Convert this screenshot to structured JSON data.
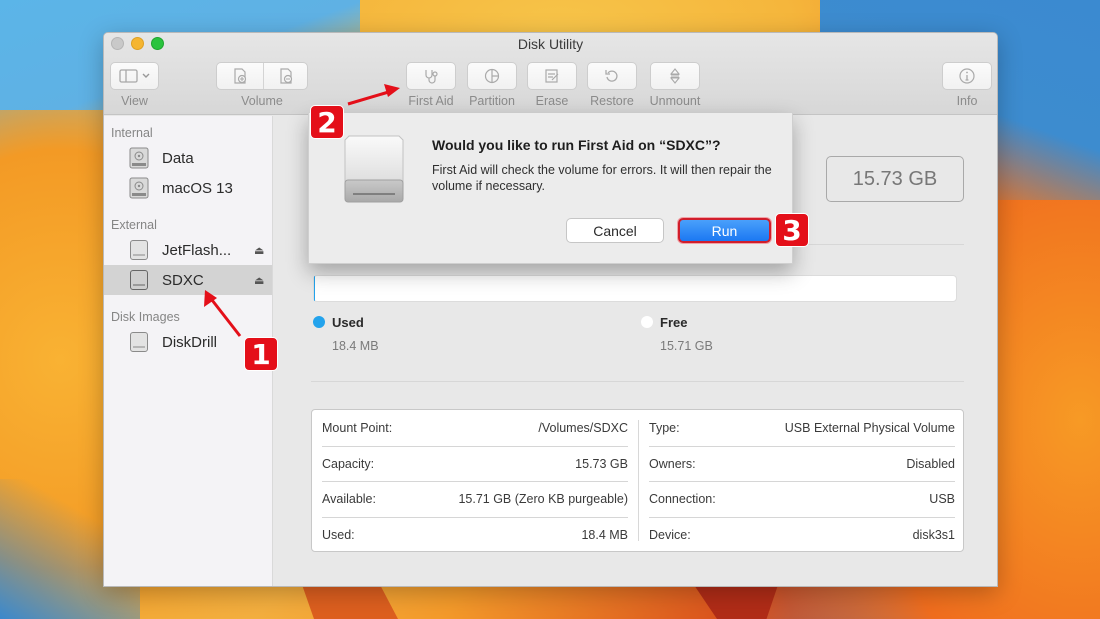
{
  "window": {
    "title": "Disk Utility",
    "traffic_lights": [
      "close",
      "minimize",
      "zoom"
    ]
  },
  "toolbar": {
    "buttons": [
      {
        "label": "View",
        "icon": "sidebar-toggle-icon"
      },
      {
        "label": "Volume",
        "icon": "add-volume-icon",
        "icon2": "remove-volume-icon"
      },
      {
        "label": "First Aid",
        "icon": "stethoscope-icon"
      },
      {
        "label": "Partition",
        "icon": "pie-icon"
      },
      {
        "label": "Erase",
        "icon": "erase-icon"
      },
      {
        "label": "Restore",
        "icon": "restore-icon"
      },
      {
        "label": "Unmount",
        "icon": "unmount-icon"
      },
      {
        "label": "Info",
        "icon": "info-icon"
      }
    ]
  },
  "sidebar": {
    "sections": [
      {
        "title": "Internal",
        "items": [
          {
            "label": "Data",
            "type": "internal"
          },
          {
            "label": "macOS 13",
            "type": "internal"
          }
        ]
      },
      {
        "title": "External",
        "items": [
          {
            "label": "JetFlash...",
            "type": "external",
            "eject": true
          },
          {
            "label": "SDXC",
            "type": "external",
            "eject": true,
            "selected": true
          }
        ]
      },
      {
        "title": "Disk Images",
        "items": [
          {
            "label": "DiskDrill",
            "type": "external"
          }
        ]
      }
    ],
    "eject_glyph": "⏏"
  },
  "main": {
    "capacity": "15.73 GB",
    "usage": {
      "used_fraction": 0.0012,
      "used_color": "#23a3ec",
      "used_label": "Used",
      "used_value": "18.4 MB",
      "free_label": "Free",
      "free_value": "15.71 GB"
    },
    "info_left": [
      {
        "key": "Mount Point:",
        "value": "/Volumes/SDXC"
      },
      {
        "key": "Capacity:",
        "value": "15.73 GB"
      },
      {
        "key": "Available:",
        "value": "15.71 GB (Zero KB purgeable)"
      },
      {
        "key": "Used:",
        "value": "18.4 MB"
      }
    ],
    "info_right": [
      {
        "key": "Type:",
        "value": "USB External Physical Volume"
      },
      {
        "key": "Owners:",
        "value": "Disabled"
      },
      {
        "key": "Connection:",
        "value": "USB"
      },
      {
        "key": "Device:",
        "value": "disk3s1"
      }
    ]
  },
  "dialog": {
    "title": "Would you like to run First Aid on “SDXC”?",
    "message": "First Aid will check the volume for errors. It will then repair the volume if necessary.",
    "cancel_label": "Cancel",
    "run_label": "Run"
  },
  "annotations": {
    "badge_1": "1",
    "badge_2": "2",
    "badge_3": "3",
    "color": "#e40f19"
  }
}
